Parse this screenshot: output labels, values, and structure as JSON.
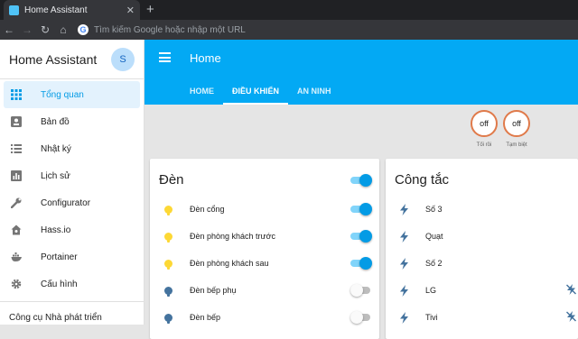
{
  "browser": {
    "tab_title": "Home Assistant",
    "tab_close": "✕",
    "new_tab": "+",
    "omnibox_placeholder": "Tìm kiếm Google hoặc nhập một URL"
  },
  "sidebar": {
    "title": "Home Assistant",
    "avatar_initial": "S",
    "items": [
      {
        "label": "Tổng quan",
        "icon": "grid-icon",
        "active": true
      },
      {
        "label": "Bản đồ",
        "icon": "map-icon"
      },
      {
        "label": "Nhật ký",
        "icon": "list-icon"
      },
      {
        "label": "Lịch sử",
        "icon": "chart-icon"
      },
      {
        "label": "Configurator",
        "icon": "wrench-icon"
      },
      {
        "label": "Hass.io",
        "icon": "home-icon"
      },
      {
        "label": "Portainer",
        "icon": "docker-icon"
      },
      {
        "label": "Cấu hình",
        "icon": "gear-icon"
      }
    ],
    "dev_tools": "Công cụ Nhà phát triển"
  },
  "header": {
    "title": "Home",
    "tabs": [
      {
        "label": "HOME"
      },
      {
        "label": "ĐIỀU KHIỂN",
        "active": true
      },
      {
        "label": "AN NINH"
      }
    ]
  },
  "badges": [
    {
      "state": "off",
      "label": "Tối rồi"
    },
    {
      "state": "off",
      "label": "Tạm biệt"
    }
  ],
  "cards": {
    "den": {
      "title": "Đèn",
      "master_on": true,
      "rows": [
        {
          "label": "Đèn cổng",
          "on": true
        },
        {
          "label": "Đèn phòng khách trước",
          "on": true
        },
        {
          "label": "Đèn phòng khách sau",
          "on": true
        },
        {
          "label": "Đèn bếp phụ",
          "on": false
        },
        {
          "label": "Đèn bếp",
          "on": false
        }
      ]
    },
    "cong_tac": {
      "title": "Công tắc",
      "rows": [
        {
          "label": "Số 3"
        },
        {
          "label": "Quạt"
        },
        {
          "label": "Số 2"
        },
        {
          "label": "LG",
          "extra_icon": true
        },
        {
          "label": "Tivi",
          "extra_icon": true
        }
      ]
    }
  },
  "colors": {
    "header": "#03a9f4",
    "accent": "#039be5",
    "badge_ring": "#e07a4a",
    "bulb_on": "#fdd835",
    "icon_off": "#44739e"
  }
}
